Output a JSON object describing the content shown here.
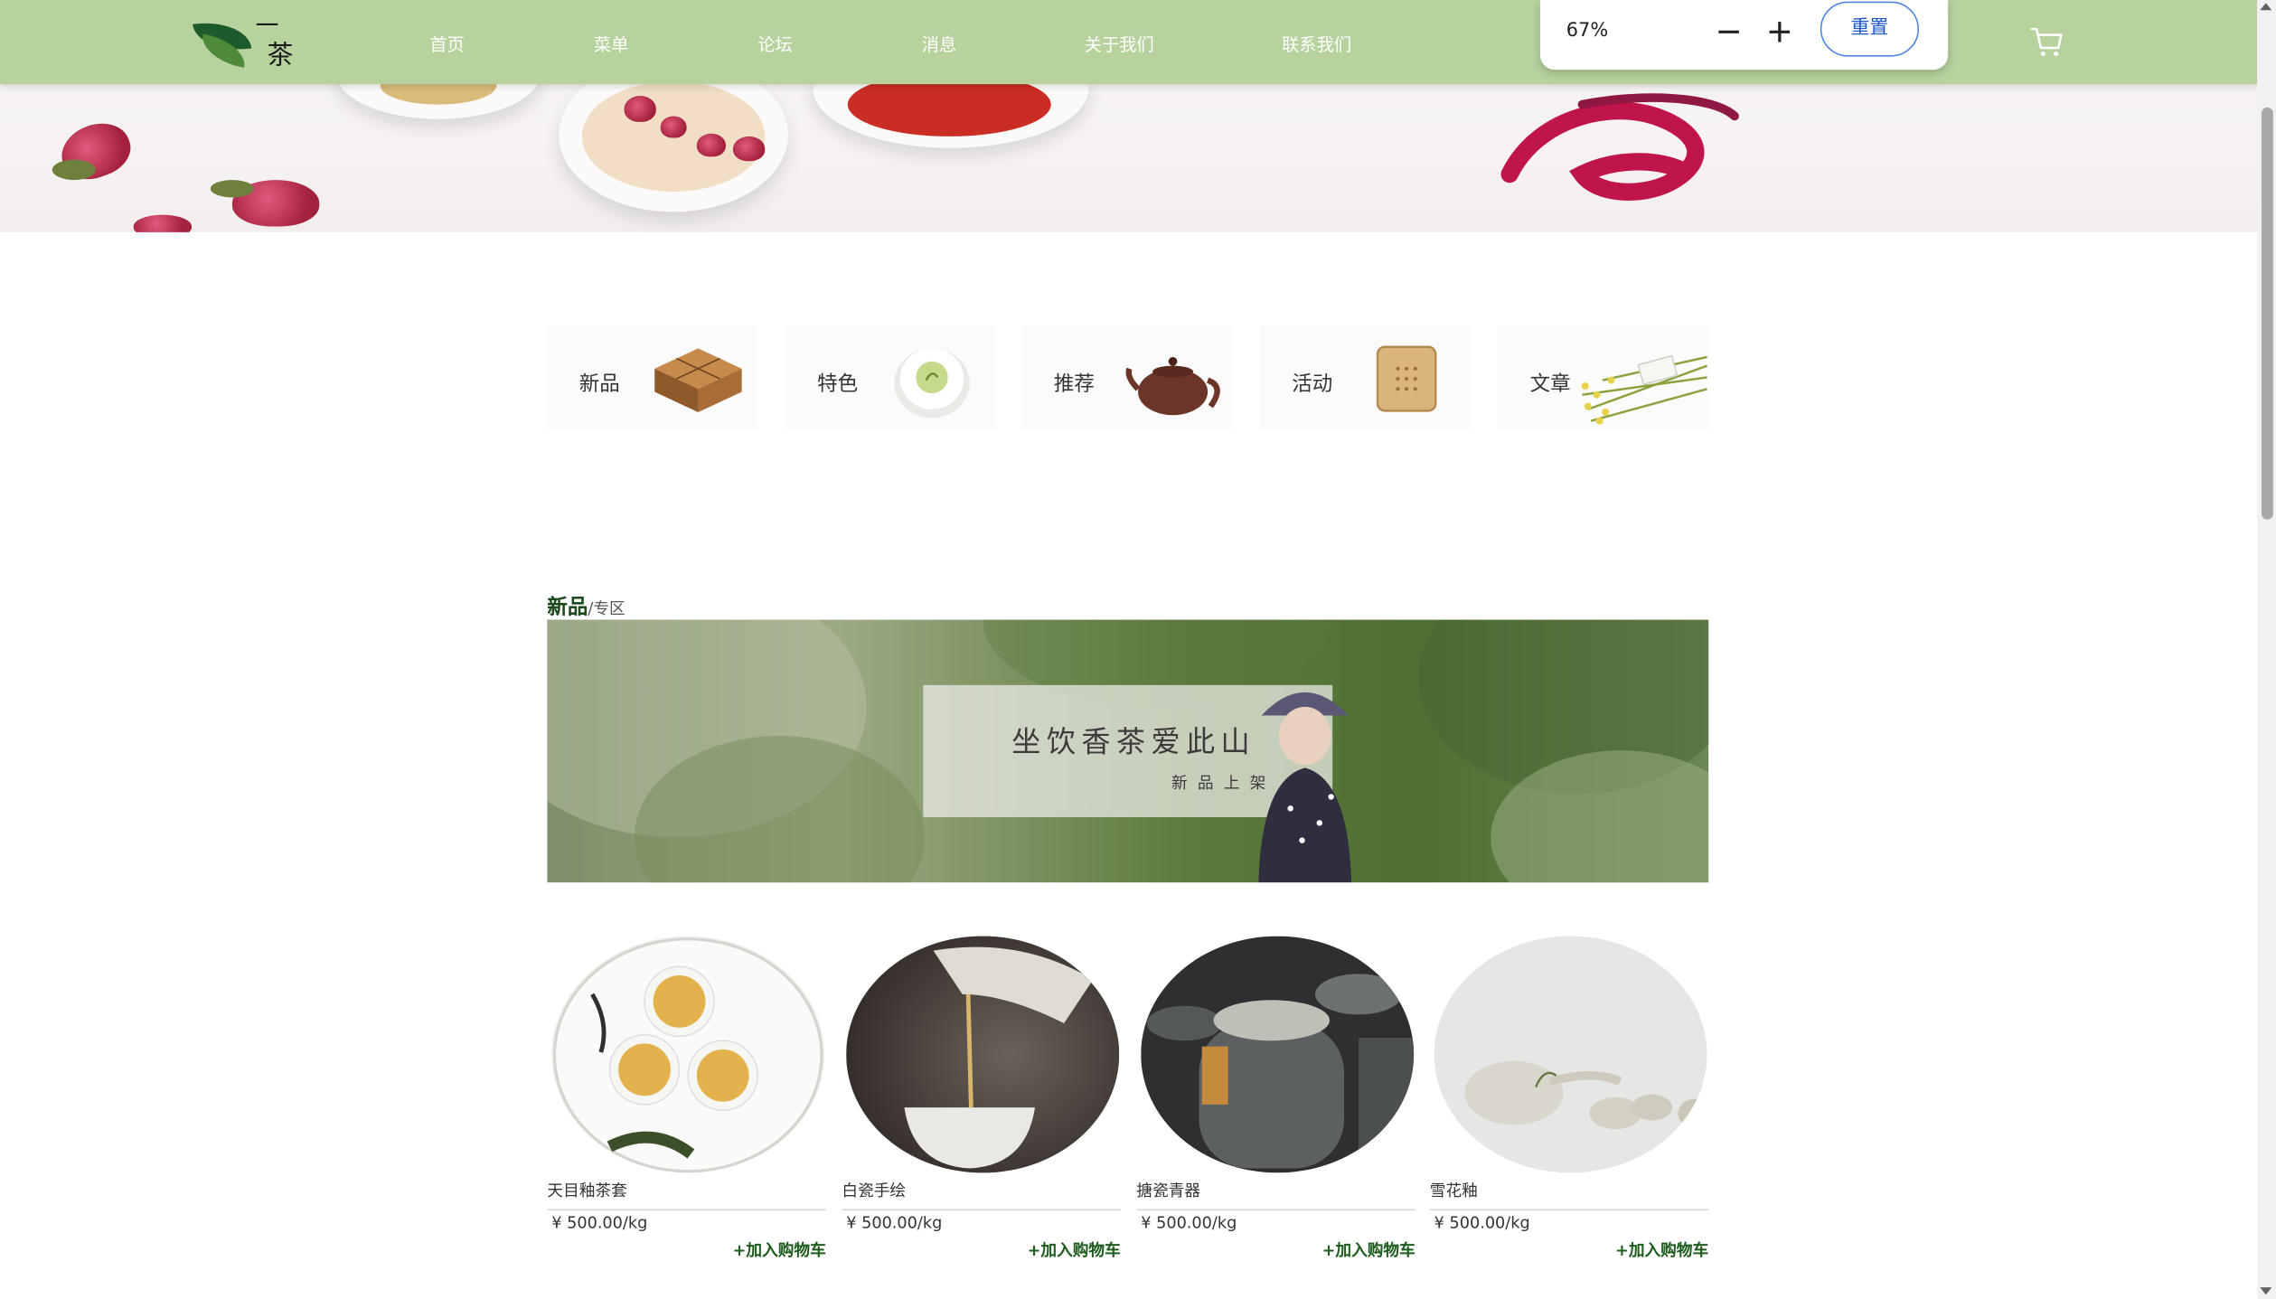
{
  "nav": {
    "logo_text_1": "一",
    "logo_text_2": "茶",
    "items": [
      "首页",
      "菜单",
      "论坛",
      "消息",
      "关于我们",
      "联系我们"
    ]
  },
  "zoom": {
    "level": "67%",
    "reset_label": "重置"
  },
  "categories": [
    {
      "label": "新品",
      "icon": "tea-brick-icon"
    },
    {
      "label": "特色",
      "icon": "tea-cup-icon"
    },
    {
      "label": "推荐",
      "icon": "teapot-icon"
    },
    {
      "label": "活动",
      "icon": "wooden-box-icon"
    },
    {
      "label": "文章",
      "icon": "herb-bundle-icon"
    }
  ],
  "section": {
    "title_main": "新品",
    "title_sub": "/专区",
    "banner_slogan": "坐饮香茶爱此山",
    "banner_tag": "新品上架"
  },
  "products": [
    {
      "name": "天目釉茶套",
      "price": "¥ 500.00/kg",
      "action": "+加入购物车"
    },
    {
      "name": "白瓷手绘",
      "price": "¥ 500.00/kg",
      "action": "+加入购物车"
    },
    {
      "name": "搪瓷青器",
      "price": "¥ 500.00/kg",
      "action": "+加入购物车"
    },
    {
      "name": "雪花釉",
      "price": "¥ 500.00/kg",
      "action": "+加入购物车"
    }
  ],
  "colors": {
    "nav_bg": "#b7d29d",
    "accent_green": "#1d5c1d",
    "zoom_reset_border": "#4f86e0"
  }
}
